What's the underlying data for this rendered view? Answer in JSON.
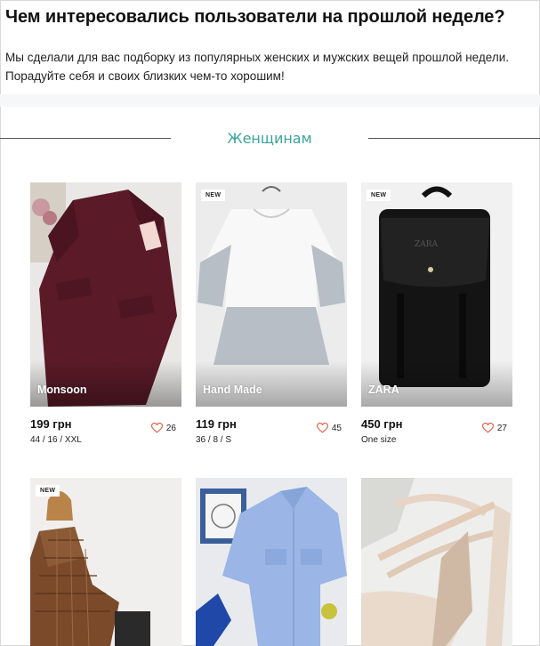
{
  "header": {
    "title": "Чем интересовались пользователи на прошлой неделе?",
    "intro_line1": "Мы сделали для вас подборку из популярных женских и мужских вещей прошлой недели.",
    "intro_line2": "Порадуйте себя и своих близких чем-то хорошим!"
  },
  "section": {
    "title": "Женщинам"
  },
  "products": [
    {
      "brand": "Monsoon",
      "price": "199 грн",
      "size": "44 / 16 / XXL",
      "likes": "26",
      "badge": "",
      "icon": "dress-photo"
    },
    {
      "brand": "Hand Made",
      "price": "119 грн",
      "size": "36 / 8 / S",
      "likes": "45",
      "badge": "NEW",
      "icon": "blouse-photo"
    },
    {
      "brand": "ZARA",
      "price": "450 грн",
      "size": "One size",
      "likes": "27",
      "badge": "NEW",
      "icon": "backpack-photo"
    },
    {
      "brand": "",
      "price": "",
      "size": "",
      "likes": "",
      "badge": "NEW",
      "icon": "coat-photo"
    },
    {
      "brand": "",
      "price": "",
      "size": "",
      "likes": "",
      "badge": "",
      "icon": "shirt-photo"
    },
    {
      "brand": "",
      "price": "",
      "size": "",
      "likes": "",
      "badge": "",
      "icon": "heels-photo"
    }
  ],
  "colors": {
    "accent": "#3aa39c",
    "heart": "#e0543d"
  }
}
